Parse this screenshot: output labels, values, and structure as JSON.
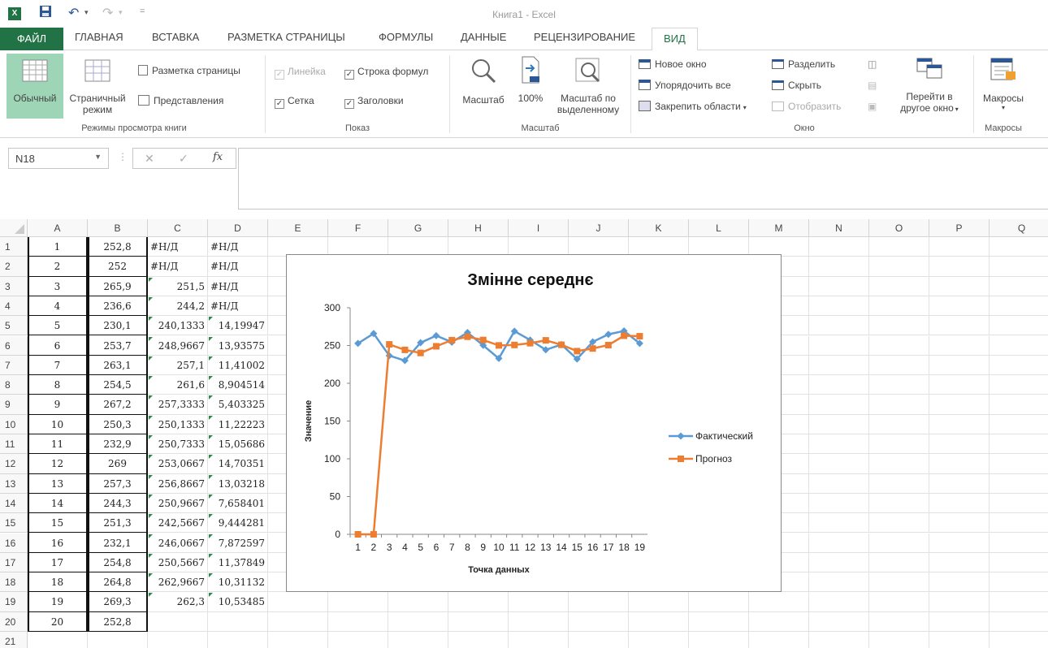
{
  "app": {
    "title": "Книга1 - Excel",
    "icon_label": "X"
  },
  "quick_access": {
    "save_icon": "save-icon",
    "undo_icon": "undo-icon",
    "redo_icon": "redo-icon"
  },
  "tabs": {
    "file": "ФАЙЛ",
    "items": [
      "ГЛАВНАЯ",
      "ВСТАВКА",
      "РАЗМЕТКА СТРАНИЦЫ",
      "ФОРМУЛЫ",
      "ДАННЫЕ",
      "РЕЦЕНЗИРОВАНИЕ",
      "ВИД"
    ],
    "active": "ВИД"
  },
  "ribbon": {
    "views": {
      "normal": "Обычный",
      "page_break_1": "Страничный",
      "page_break_2": "режим",
      "page_layout": "Разметка страницы",
      "custom_views": "Представления",
      "group": "Режимы просмотра книги"
    },
    "show": {
      "ruler": "Линейка",
      "formula_bar": "Строка формул",
      "gridlines": "Сетка",
      "headings": "Заголовки",
      "group": "Показ"
    },
    "zoom": {
      "zoom": "Масштаб",
      "hundred": "100%",
      "zoom_sel_1": "Масштаб по",
      "zoom_sel_2": "выделенному",
      "group": "Масштаб"
    },
    "window": {
      "new_window": "Новое окно",
      "arrange_all": "Упорядочить все",
      "freeze": "Закрепить области",
      "split": "Разделить",
      "hide": "Скрыть",
      "unhide": "Отобразить",
      "switch_1": "Перейти в",
      "switch_2": "другое окно",
      "group": "Окно"
    },
    "macros": {
      "label": "Макросы",
      "group": "Макросы"
    }
  },
  "formula_bar": {
    "name_box": "N18",
    "fx": "fx",
    "cancel": "✕",
    "enter": "✓"
  },
  "columns": [
    "A",
    "B",
    "C",
    "D",
    "E",
    "F",
    "G",
    "H",
    "I",
    "J",
    "K",
    "L",
    "M",
    "N",
    "O",
    "P",
    "Q"
  ],
  "rows": [
    [
      "1",
      "252,8",
      "#Н/Д",
      "#Н/Д"
    ],
    [
      "2",
      "252",
      "#Н/Д",
      "#Н/Д"
    ],
    [
      "3",
      "265,9",
      "251,5",
      "#Н/Д"
    ],
    [
      "4",
      "236,6",
      "244,2",
      "#Н/Д"
    ],
    [
      "5",
      "230,1",
      "240,1333",
      "14,19947"
    ],
    [
      "6",
      "253,7",
      "248,9667",
      "13,93575"
    ],
    [
      "7",
      "263,1",
      "257,1",
      "11,41002"
    ],
    [
      "8",
      "254,5",
      "261,6",
      "8,904514"
    ],
    [
      "9",
      "267,2",
      "257,3333",
      "5,403325"
    ],
    [
      "10",
      "250,3",
      "250,1333",
      "11,22223"
    ],
    [
      "11",
      "232,9",
      "250,7333",
      "15,05686"
    ],
    [
      "12",
      "269",
      "253,0667",
      "14,70351"
    ],
    [
      "13",
      "257,3",
      "256,8667",
      "13,03218"
    ],
    [
      "14",
      "244,3",
      "250,9667",
      "7,658401"
    ],
    [
      "15",
      "251,3",
      "242,5667",
      "9,444281"
    ],
    [
      "16",
      "232,1",
      "246,0667",
      "7,872597"
    ],
    [
      "17",
      "254,8",
      "250,5667",
      "11,37849"
    ],
    [
      "18",
      "264,8",
      "262,9667",
      "10,31132"
    ],
    [
      "19",
      "269,3",
      "262,3",
      "10,53485"
    ],
    [
      "20",
      "252,8",
      "",
      ""
    ],
    [
      "",
      "",
      "",
      ""
    ]
  ],
  "chart_data": {
    "type": "line",
    "title": "Змінне середнє",
    "xlabel": "Точка данных",
    "ylabel": "Значение",
    "ylim": [
      0,
      300
    ],
    "yticks": [
      0,
      50,
      100,
      150,
      200,
      250,
      300
    ],
    "categories": [
      "1",
      "2",
      "3",
      "4",
      "5",
      "6",
      "7",
      "8",
      "9",
      "10",
      "11",
      "12",
      "13",
      "14",
      "15",
      "16",
      "17",
      "18",
      "19"
    ],
    "legend_position": "right",
    "grid": false,
    "series": [
      {
        "name": "Фактический",
        "color": "#5b9bd5",
        "marker": "diamond",
        "values": [
          252.8,
          265.9,
          236.6,
          230.1,
          253.7,
          263.1,
          254.5,
          267.2,
          250.3,
          232.9,
          269,
          257.3,
          244.3,
          251.3,
          232.1,
          254.8,
          264.8,
          269.3,
          252.8
        ]
      },
      {
        "name": "Прогноз",
        "color": "#ed7d31",
        "marker": "square",
        "values": [
          0,
          0,
          251.5,
          244.2,
          240.1333,
          248.9667,
          257.1,
          261.6,
          257.3333,
          250.1333,
          250.7333,
          253.0667,
          256.8667,
          250.9667,
          242.5667,
          246.0667,
          250.5667,
          262.9667,
          262.3
        ]
      }
    ]
  }
}
